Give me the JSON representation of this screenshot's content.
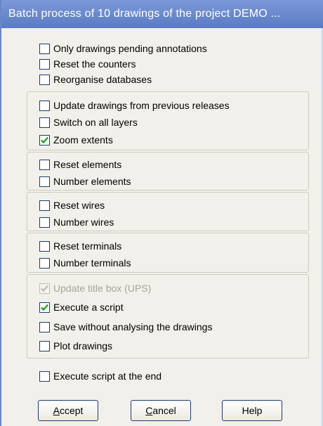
{
  "window": {
    "title": "Batch process of 10 drawings of the project DEMO    ..."
  },
  "options": {
    "pending": {
      "label": "Only drawings pending annotations",
      "checked": false
    },
    "reset_counters": {
      "label": "Reset the counters",
      "checked": false
    },
    "reorganise": {
      "label": "Reorganise databases",
      "checked": false
    },
    "update_drawings": {
      "label": "Update drawings from previous releases",
      "checked": false
    },
    "switch_layers": {
      "label": "Switch on all layers",
      "checked": false
    },
    "zoom_extents": {
      "label": "Zoom extents",
      "checked": true
    },
    "reset_elements": {
      "label": "Reset elements",
      "checked": false
    },
    "number_elements": {
      "label": "Number elements",
      "checked": false
    },
    "reset_wires": {
      "label": "Reset wires",
      "checked": false
    },
    "number_wires": {
      "label": "Number wires",
      "checked": false
    },
    "reset_terminals": {
      "label": "Reset terminals",
      "checked": false
    },
    "number_terminals": {
      "label": "Number terminals",
      "checked": false
    },
    "update_title_box": {
      "label": "Update title box (UPS)",
      "checked": true,
      "disabled": true
    },
    "execute_script": {
      "label": "Execute a script",
      "checked": true
    },
    "save_without": {
      "label": "Save without analysing the drawings",
      "checked": false
    },
    "plot": {
      "label": "Plot drawings",
      "checked": false
    },
    "script_end": {
      "label": "Execute script at the end",
      "checked": false
    }
  },
  "buttons": {
    "accept": {
      "mnemonic": "A",
      "rest": "ccept"
    },
    "cancel": {
      "mnemonic": "C",
      "rest": "ancel"
    },
    "help": {
      "label": "Help"
    }
  },
  "colors": {
    "titlebar": "#6f8fd3",
    "check": "#1fa31f",
    "panel": "#f1f0ea"
  }
}
